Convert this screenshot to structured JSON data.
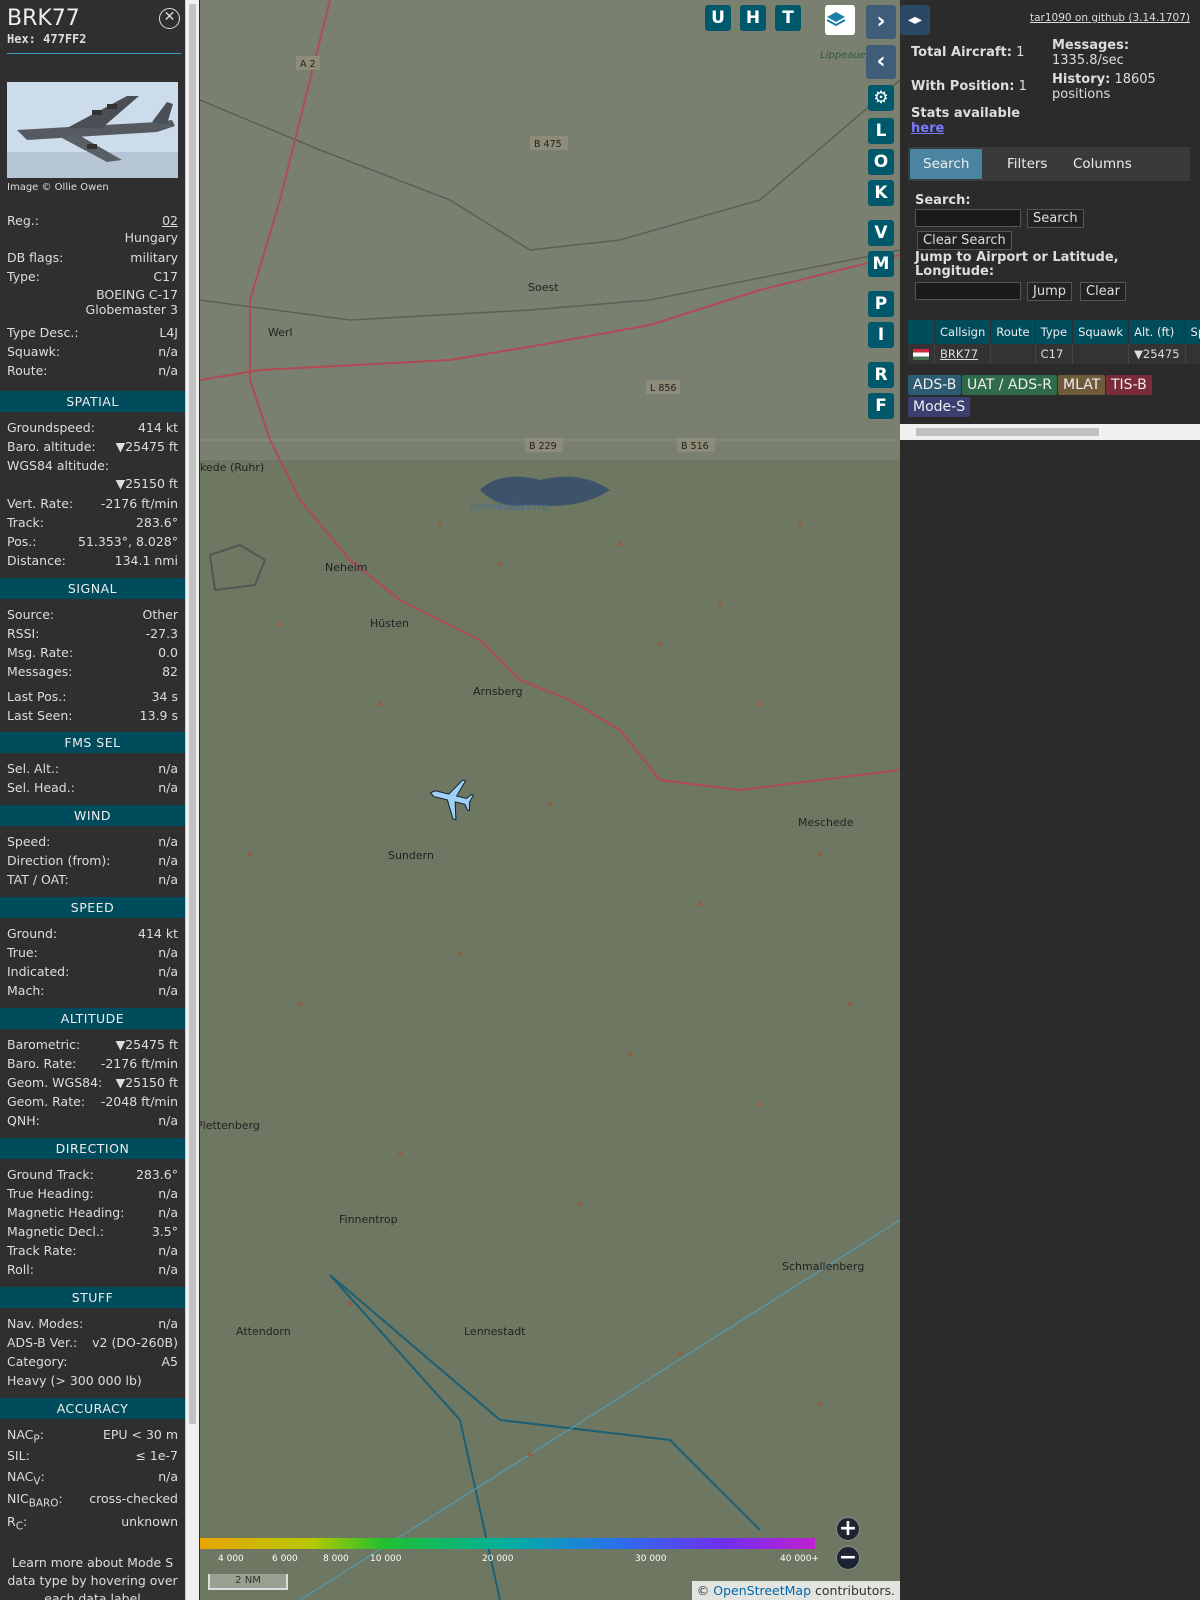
{
  "aircraft": {
    "callsign": "BRK77",
    "hex_label": "Hex:",
    "hex": "477FF2",
    "image_credit": "Image © Ollie Owen",
    "reg_label": "Reg.:",
    "reg": "02",
    "country": "Hungary",
    "dbflags_label": "DB flags:",
    "dbflags": "military",
    "type_label": "Type:",
    "type": "C17",
    "type_full_1": "BOEING C-17",
    "type_full_2": "Globemaster 3",
    "typedesc_label": "Type Desc.:",
    "typedesc": "L4J",
    "squawk_label": "Squawk:",
    "squawk": "n/a",
    "route_label": "Route:",
    "route": "n/a"
  },
  "spatial": {
    "title": "SPATIAL",
    "groundspeed_label": "Groundspeed:",
    "groundspeed": "414 kt",
    "baro_label": "Baro. altitude:",
    "baro": "▼25475 ft",
    "wgs_label": "WGS84 altitude:",
    "wgs": "▼25150 ft",
    "vrate_label": "Vert. Rate:",
    "vrate": "-2176 ft/min",
    "track_label": "Track:",
    "track": "283.6°",
    "pos_label": "Pos.:",
    "pos": "51.353°, 8.028°",
    "dist_label": "Distance:",
    "dist": "134.1 nmi"
  },
  "signal": {
    "title": "SIGNAL",
    "source_label": "Source:",
    "source": "Other",
    "rssi_label": "RSSI:",
    "rssi": "-27.3",
    "msgrate_label": "Msg. Rate:",
    "msgrate": "0.0",
    "messages_label": "Messages:",
    "messages": "82",
    "lastpos_label": "Last Pos.:",
    "lastpos": "34 s",
    "lastseen_label": "Last Seen:",
    "lastseen": "13.9 s"
  },
  "fms": {
    "title": "FMS SEL",
    "selalt_label": "Sel. Alt.:",
    "selalt": "n/a",
    "selhead_label": "Sel. Head.:",
    "selhead": "n/a"
  },
  "wind": {
    "title": "WIND",
    "speed_label": "Speed:",
    "speed": "n/a",
    "dir_label": "Direction (from):",
    "dir": "n/a",
    "tat_label": "TAT / OAT:",
    "tat": "n/a"
  },
  "speed": {
    "title": "SPEED",
    "ground_label": "Ground:",
    "ground": "414 kt",
    "true_label": "True:",
    "true": "n/a",
    "ind_label": "Indicated:",
    "ind": "n/a",
    "mach_label": "Mach:",
    "mach": "n/a"
  },
  "altitude": {
    "title": "ALTITUDE",
    "baro_label": "Barometric:",
    "baro": "▼25475 ft",
    "barorate_label": "Baro. Rate:",
    "barorate": "-2176 ft/min",
    "geom_label": "Geom. WGS84:",
    "geom": "▼25150 ft",
    "geomrate_label": "Geom. Rate:",
    "geomrate": "-2048 ft/min",
    "qnh_label": "QNH:",
    "qnh": "n/a"
  },
  "direction": {
    "title": "DIRECTION",
    "gtrack_label": "Ground Track:",
    "gtrack": "283.6°",
    "thead_label": "True Heading:",
    "thead": "n/a",
    "mhead_label": "Magnetic Heading:",
    "mhead": "n/a",
    "mdecl_label": "Magnetic Decl.:",
    "mdecl": "3.5°",
    "trate_label": "Track Rate:",
    "trate": "n/a",
    "roll_label": "Roll:",
    "roll": "n/a"
  },
  "stuff": {
    "title": "STUFF",
    "nav_label": "Nav. Modes:",
    "nav": "n/a",
    "adsb_label": "ADS-B Ver.:",
    "adsb": "v2 (DO-260B)",
    "cat_label": "Category:",
    "cat": "A5",
    "heavy": "Heavy (> 300 000 lb)"
  },
  "accuracy": {
    "title": "ACCURACY",
    "nacp_label": "NAC",
    "nacp_sub": "P",
    "nacp": "EPU < 30 m",
    "sil_label": "SIL:",
    "sil": "≤ 1e-7",
    "nacv_label": "NAC",
    "nacv_sub": "V",
    "nacv": "n/a",
    "nic_label": "NIC",
    "nic_sub": "BARO",
    "nic": "cross-checked",
    "rc_label": "R",
    "rc_sub": "C",
    "rc": "unknown"
  },
  "footer_text": "Learn more about Mode S data type by hovering over each data label",
  "map": {
    "top_buttons": [
      "U",
      "H",
      "T"
    ],
    "side_buttons": [
      "L",
      "O",
      "K",
      "V",
      "M",
      "P",
      "I",
      "R",
      "F"
    ],
    "places": [
      {
        "name": "Soest"
      },
      {
        "name": "Werl"
      },
      {
        "name": "Neheim"
      },
      {
        "name": "Hüsten"
      },
      {
        "name": "Arnsberg"
      },
      {
        "name": "Sundern"
      },
      {
        "name": "Meschede"
      },
      {
        "name": "Plettenberg"
      },
      {
        "name": "Finnentrop"
      },
      {
        "name": "Attendorn"
      },
      {
        "name": "Lennestadt"
      },
      {
        "name": "Schmallenberg"
      },
      {
        "name": "kede (Ruhr)"
      },
      {
        "name": "Möhnetalsperre"
      },
      {
        "name": "Lippeaue"
      }
    ],
    "roads": [
      "A 2",
      "B 475",
      "B 229",
      "B 516",
      "L 856"
    ],
    "alt_scale": [
      "4 000",
      "6 000",
      "8 000",
      "10 000",
      "20 000",
      "30 000",
      "40 000+"
    ],
    "scale_bar": "2 NM",
    "attribution_prefix": "© ",
    "attribution_link": "OpenStreetMap",
    "attribution_suffix": " contributors."
  },
  "right": {
    "github": "tar1090 on github (3.14.1707)",
    "total_label": "Total Aircraft:",
    "total": "1",
    "withpos_label": "With Position:",
    "withpos": "1",
    "messages_label": "Messages:",
    "messages": "1335.8/sec",
    "history_label": "History:",
    "history": "18605 positions",
    "stats_label": "Stats available",
    "stats_link": "here",
    "tabs": [
      "Search",
      "Filters",
      "Columns"
    ],
    "search_label": "Search:",
    "search_btn": "Search",
    "clear_search_btn": "Clear Search",
    "jump_label": "Jump to Airport or Latitude, Longitude:",
    "jump_btn": "Jump",
    "clear_btn": "Clear",
    "table_headers": [
      "",
      "Callsign",
      "Route",
      "Type",
      "Squawk",
      "Alt. (ft)",
      "Spd"
    ],
    "table_row": {
      "callsign": "BRK77",
      "route": "",
      "type": "C17",
      "squawk": "",
      "alt": "▼25475",
      "spd": ""
    },
    "legend": [
      {
        "label": "ADS-B",
        "color": "#2f5a73"
      },
      {
        "label": "UAT / ADS-R",
        "color": "#2f6a4a"
      },
      {
        "label": "MLAT",
        "color": "#6f5a3a"
      },
      {
        "label": "TIS-B",
        "color": "#7a2b3a"
      },
      {
        "label": "Mode-S",
        "color": "#3a3f6f"
      }
    ]
  }
}
